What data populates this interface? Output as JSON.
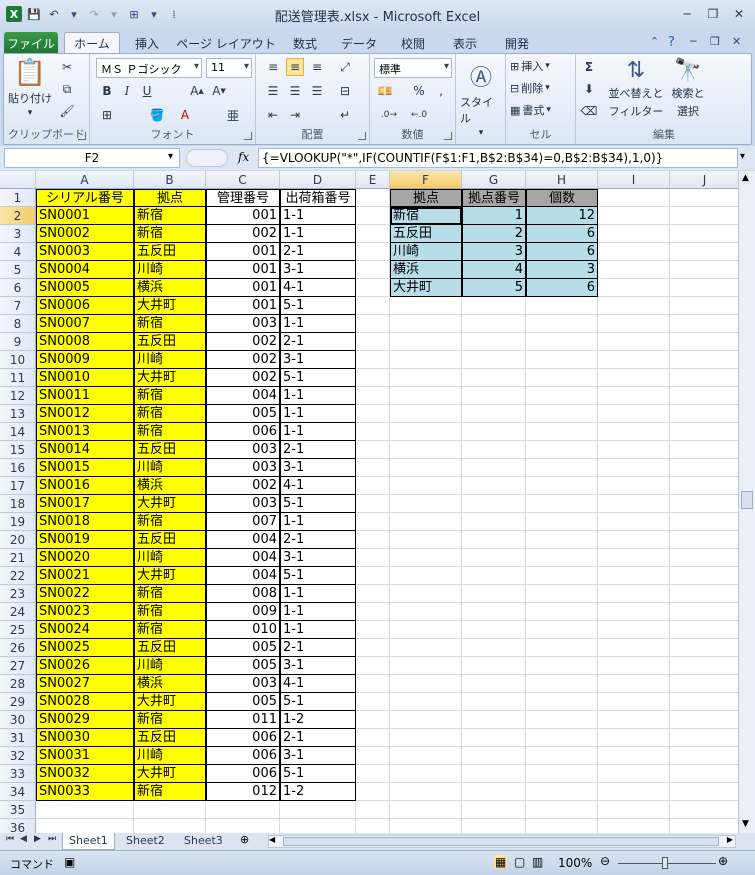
{
  "window": {
    "title": "配送管理表.xlsx - Microsoft Excel"
  },
  "tabs": {
    "file": "ファイル",
    "home": "ホーム",
    "insert": "挿入",
    "page_layout": "ページ レイアウト",
    "formulas": "数式",
    "data": "データ",
    "review": "校閲",
    "view": "表示",
    "developer": "開発"
  },
  "ribbon": {
    "clipboard": {
      "label": "クリップボード",
      "paste": "貼り付け"
    },
    "font": {
      "label": "フォント",
      "name": "ＭＳ Ｐゴシック",
      "size": "11"
    },
    "alignment": {
      "label": "配置"
    },
    "number": {
      "label": "数値",
      "format": "標準"
    },
    "styles": {
      "label": "スタイル"
    },
    "cells": {
      "label": "セル",
      "insert": "挿入",
      "delete": "削除",
      "format": "書式"
    },
    "editing": {
      "label": "編集",
      "sort_filter_1": "並べ替えと",
      "sort_filter_2": "フィルター",
      "find_select_1": "検索と",
      "find_select_2": "選択"
    }
  },
  "formula_bar": {
    "name_box": "F2",
    "fx": "fx",
    "formula": "{=VLOOKUP(\"*\",IF(COUNTIF(F$1:F1,B$2:B$34)=0,B$2:B$34),1,0)}"
  },
  "columns": [
    "A",
    "B",
    "C",
    "D",
    "E",
    "F",
    "G",
    "H",
    "I",
    "J"
  ],
  "selected_column": "F",
  "selected_row": 2,
  "rows": [
    "1",
    "2",
    "3",
    "4",
    "5",
    "6",
    "7",
    "8",
    "9",
    "10",
    "11",
    "12",
    "13",
    "14",
    "15",
    "16",
    "17",
    "18",
    "19",
    "20",
    "21",
    "22",
    "23",
    "24",
    "25",
    "26",
    "27",
    "28",
    "29",
    "30",
    "31",
    "32",
    "33",
    "34",
    "35",
    "36"
  ],
  "main_table": {
    "headers": [
      "シリアル番号",
      "拠点",
      "管理番号",
      "出荷箱番号"
    ],
    "rows": [
      [
        "SN0001",
        "新宿",
        "001",
        "1-1"
      ],
      [
        "SN0002",
        "新宿",
        "002",
        "1-1"
      ],
      [
        "SN0003",
        "五反田",
        "001",
        "2-1"
      ],
      [
        "SN0004",
        "川崎",
        "001",
        "3-1"
      ],
      [
        "SN0005",
        "横浜",
        "001",
        "4-1"
      ],
      [
        "SN0006",
        "大井町",
        "001",
        "5-1"
      ],
      [
        "SN0007",
        "新宿",
        "003",
        "1-1"
      ],
      [
        "SN0008",
        "五反田",
        "002",
        "2-1"
      ],
      [
        "SN0009",
        "川崎",
        "002",
        "3-1"
      ],
      [
        "SN0010",
        "大井町",
        "002",
        "5-1"
      ],
      [
        "SN0011",
        "新宿",
        "004",
        "1-1"
      ],
      [
        "SN0012",
        "新宿",
        "005",
        "1-1"
      ],
      [
        "SN0013",
        "新宿",
        "006",
        "1-1"
      ],
      [
        "SN0014",
        "五反田",
        "003",
        "2-1"
      ],
      [
        "SN0015",
        "川崎",
        "003",
        "3-1"
      ],
      [
        "SN0016",
        "横浜",
        "002",
        "4-1"
      ],
      [
        "SN0017",
        "大井町",
        "003",
        "5-1"
      ],
      [
        "SN0018",
        "新宿",
        "007",
        "1-1"
      ],
      [
        "SN0019",
        "五反田",
        "004",
        "2-1"
      ],
      [
        "SN0020",
        "川崎",
        "004",
        "3-1"
      ],
      [
        "SN0021",
        "大井町",
        "004",
        "5-1"
      ],
      [
        "SN0022",
        "新宿",
        "008",
        "1-1"
      ],
      [
        "SN0023",
        "新宿",
        "009",
        "1-1"
      ],
      [
        "SN0024",
        "新宿",
        "010",
        "1-1"
      ],
      [
        "SN0025",
        "五反田",
        "005",
        "2-1"
      ],
      [
        "SN0026",
        "川崎",
        "005",
        "3-1"
      ],
      [
        "SN0027",
        "横浜",
        "003",
        "4-1"
      ],
      [
        "SN0028",
        "大井町",
        "005",
        "5-1"
      ],
      [
        "SN0029",
        "新宿",
        "011",
        "1-2"
      ],
      [
        "SN0030",
        "五反田",
        "006",
        "2-1"
      ],
      [
        "SN0031",
        "川崎",
        "006",
        "3-1"
      ],
      [
        "SN0032",
        "大井町",
        "006",
        "5-1"
      ],
      [
        "SN0033",
        "新宿",
        "012",
        "1-2"
      ]
    ]
  },
  "summary_table": {
    "headers": [
      "拠点",
      "拠点番号",
      "個数"
    ],
    "rows": [
      [
        "新宿",
        "1",
        "12"
      ],
      [
        "五反田",
        "2",
        "6"
      ],
      [
        "川崎",
        "3",
        "6"
      ],
      [
        "横浜",
        "4",
        "3"
      ],
      [
        "大井町",
        "5",
        "6"
      ]
    ]
  },
  "sheets": [
    "Sheet1",
    "Sheet2",
    "Sheet3"
  ],
  "active_sheet": "Sheet1",
  "status": {
    "mode": "コマンド",
    "zoom": "100%"
  },
  "colors": {
    "yellow": "#ffff00",
    "blue": "#b7dde8",
    "grey": "#a6a6a6",
    "selection_header": "#f4cb6a"
  }
}
